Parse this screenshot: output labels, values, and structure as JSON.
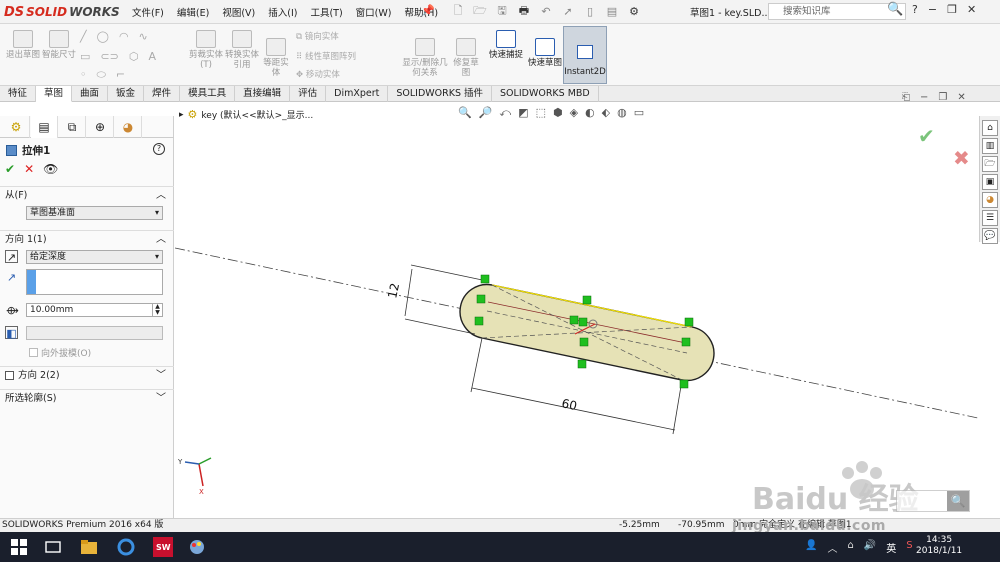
{
  "app": {
    "logo_ds": "DS",
    "logo_text_a": "SOLID",
    "logo_text_b": "WORKS",
    "doc_title": "草图1 - key.SLD..."
  },
  "menus": [
    "文件(F)",
    "编辑(E)",
    "视图(V)",
    "插入(I)",
    "工具(T)",
    "窗口(W)",
    "帮助(H)"
  ],
  "search": {
    "placeholder": "搜索知识库"
  },
  "toolbar": {
    "exit_sketch": "退出草图",
    "smart_dim": "智能尺寸",
    "trim_entities": "剪裁实体(T)",
    "convert_entities": "转换实体引用",
    "offset_entities": "等距实体",
    "mirror_entities": "镜向实体",
    "linear_pattern": "线性草图阵列",
    "move_entities": "移动实体",
    "display_relations": "显示/删除几何关系",
    "repair_sketch": "修复草图",
    "quick_snaps": "快速捕捉",
    "rapid_sketch": "快速草图",
    "instant2d": "Instant2D"
  },
  "tabs": [
    "特征",
    "草图",
    "曲面",
    "钣金",
    "焊件",
    "模具工具",
    "直接编辑",
    "评估",
    "DimXpert",
    "SOLIDWORKS 插件",
    "SOLIDWORKS MBD"
  ],
  "active_tab": "草图",
  "feature_tree": {
    "label": "key  (默认<<默认>_显示..."
  },
  "property_manager": {
    "title": "拉伸1",
    "from_label": "从(F)",
    "from_value": "草图基准面",
    "dir1_label": "方向 1(1)",
    "end_condition": "给定深度",
    "depth": "10.00mm",
    "draft_outward": "向外拔模(O)",
    "dir2_label": "方向 2(2)",
    "contours_label": "所选轮廓(S)"
  },
  "dimensions": {
    "width": "12",
    "length": "60"
  },
  "status": {
    "product": "SOLIDWORKS Premium 2016 x64 版",
    "x": "-5.25mm",
    "y": "-70.95mm",
    "z": "0mm 完全定义  在编辑 草图1"
  },
  "taskbar": {
    "time": "14:35",
    "date": "2018/1/11",
    "ime": "英"
  },
  "watermark": {
    "text": "Baidu 经验",
    "url": "jingyan.baidu.com"
  },
  "colors": {
    "accent": "#2a5db0",
    "slot_fill": "#e6e2b6",
    "relation_green": "#1fbf1f",
    "ok": "#2a9d2a",
    "cancel": "#dd2222"
  }
}
